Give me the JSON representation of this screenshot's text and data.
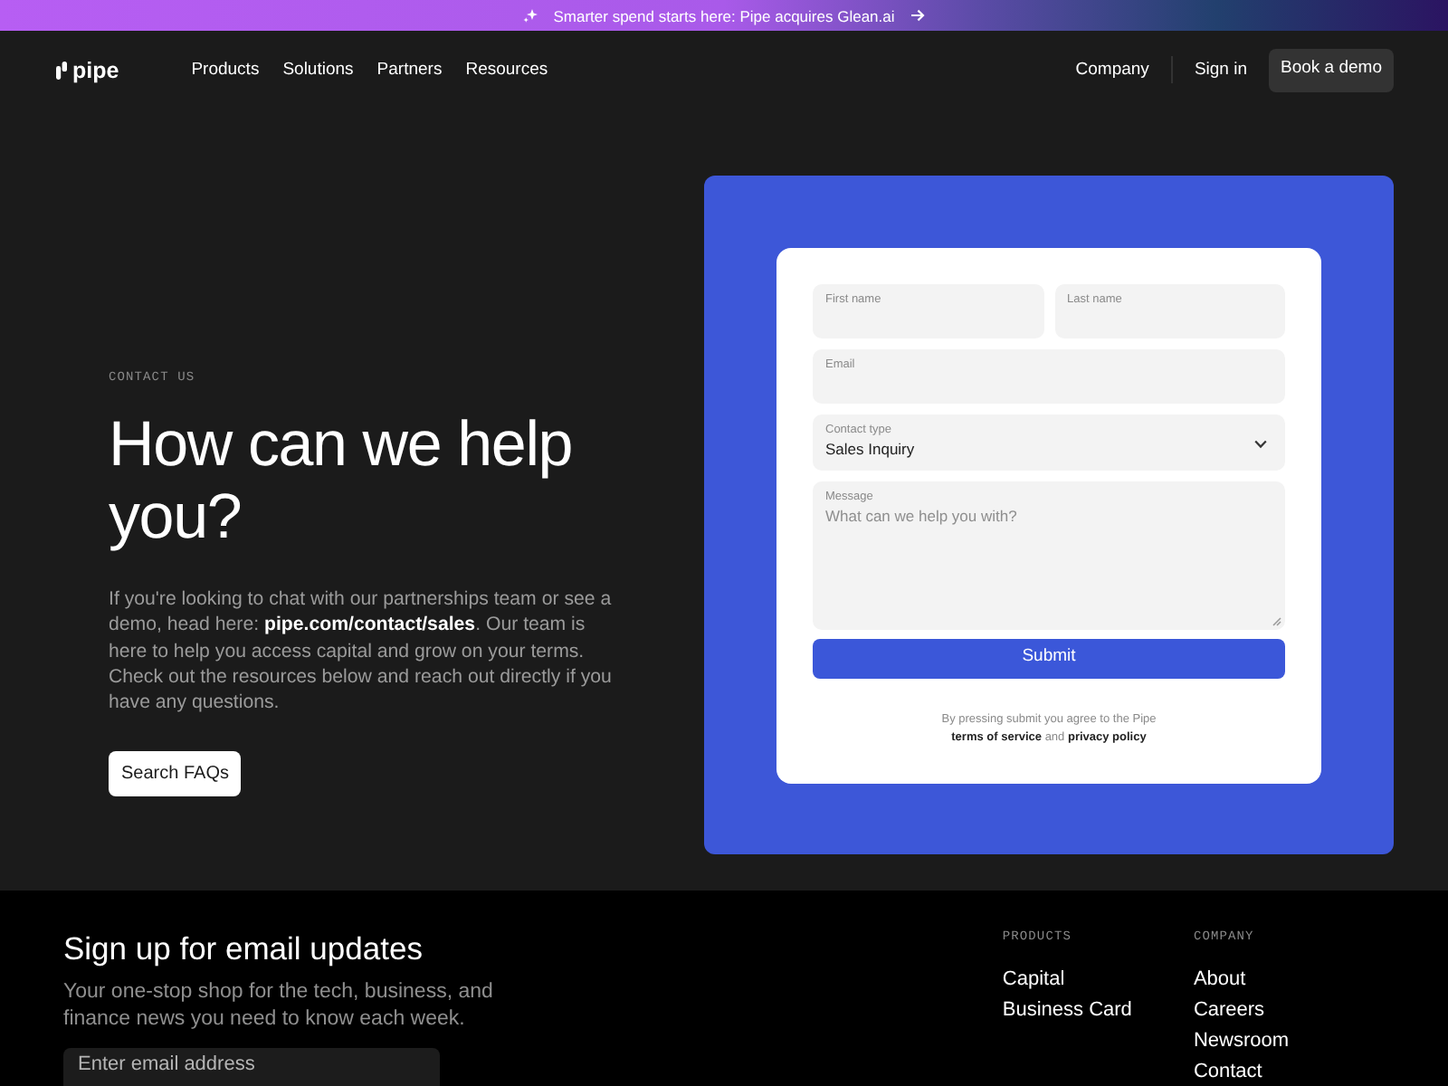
{
  "announcement": {
    "text": "Smarter spend starts here: Pipe acquires Glean.ai"
  },
  "nav": {
    "logo": "pipe",
    "links": [
      {
        "label": "Products"
      },
      {
        "label": "Solutions"
      },
      {
        "label": "Partners"
      },
      {
        "label": "Resources"
      }
    ],
    "right_links": [
      {
        "label": "Company"
      },
      {
        "label": "Sign in"
      }
    ],
    "cta": "Book a demo"
  },
  "hero": {
    "eyebrow": "CONTACT US",
    "heading": "How can we help you?",
    "description": [
      {
        "kind": "text",
        "text": "If you're looking to chat with our partnerships team or see a demo, head here: "
      },
      {
        "kind": "link",
        "text": "pipe.com/contact/sales"
      },
      {
        "kind": "text",
        "text": ". Our team is here to help you access capital and grow on your terms. Check out the resources below and reach out directly if you have any questions."
      }
    ],
    "button": "Search FAQs"
  },
  "form": {
    "rows": [
      [
        {
          "kind": "text",
          "label": "First name"
        },
        {
          "kind": "text",
          "label": "Last name"
        }
      ],
      [
        {
          "kind": "text",
          "label": "Email"
        }
      ],
      [
        {
          "kind": "select",
          "label": "Contact type",
          "value": "Sales Inquiry"
        }
      ],
      [
        {
          "kind": "textarea",
          "label": "Message",
          "placeholder": "What can we help you with?"
        }
      ]
    ],
    "submit": "Submit",
    "legal": [
      {
        "kind": "text",
        "text": "By pressing submit you agree to the Pipe "
      },
      {
        "kind": "link",
        "text": "terms of service"
      },
      {
        "kind": "text",
        "text": " and "
      },
      {
        "kind": "link",
        "text": "privacy policy"
      }
    ]
  },
  "footer": {
    "newsletter": {
      "title": "Sign up for email updates",
      "text": "Your one-stop shop for the tech, business, and finance news you need to know each week.",
      "email": {
        "placeholder": "Enter email address"
      }
    },
    "columns": [
      {
        "heading": "PRODUCTS",
        "links": [
          "Capital",
          "Business Card"
        ]
      },
      {
        "heading": "COMPANY",
        "links": [
          "About",
          "Careers",
          "Newsroom",
          "Contact"
        ]
      }
    ]
  }
}
